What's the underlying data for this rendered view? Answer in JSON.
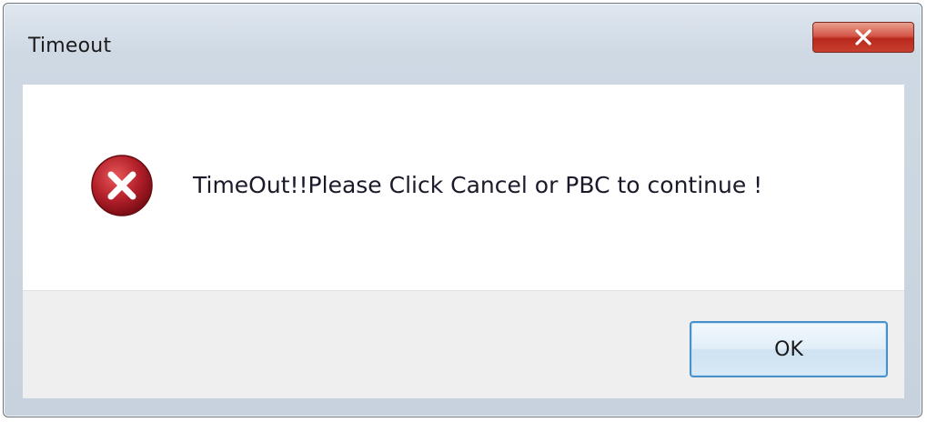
{
  "dialog": {
    "title": "Timeout",
    "message": "TimeOut!!Please Click Cancel or PBC to continue !",
    "ok_label": "OK",
    "close_icon": "close-icon",
    "status_icon": "error-icon"
  },
  "colors": {
    "close_button": "#c8402f",
    "error_icon": "#b3202a",
    "ok_border": "#4a90c8",
    "content_bg": "#ffffff",
    "footer_bg": "#efefef"
  }
}
